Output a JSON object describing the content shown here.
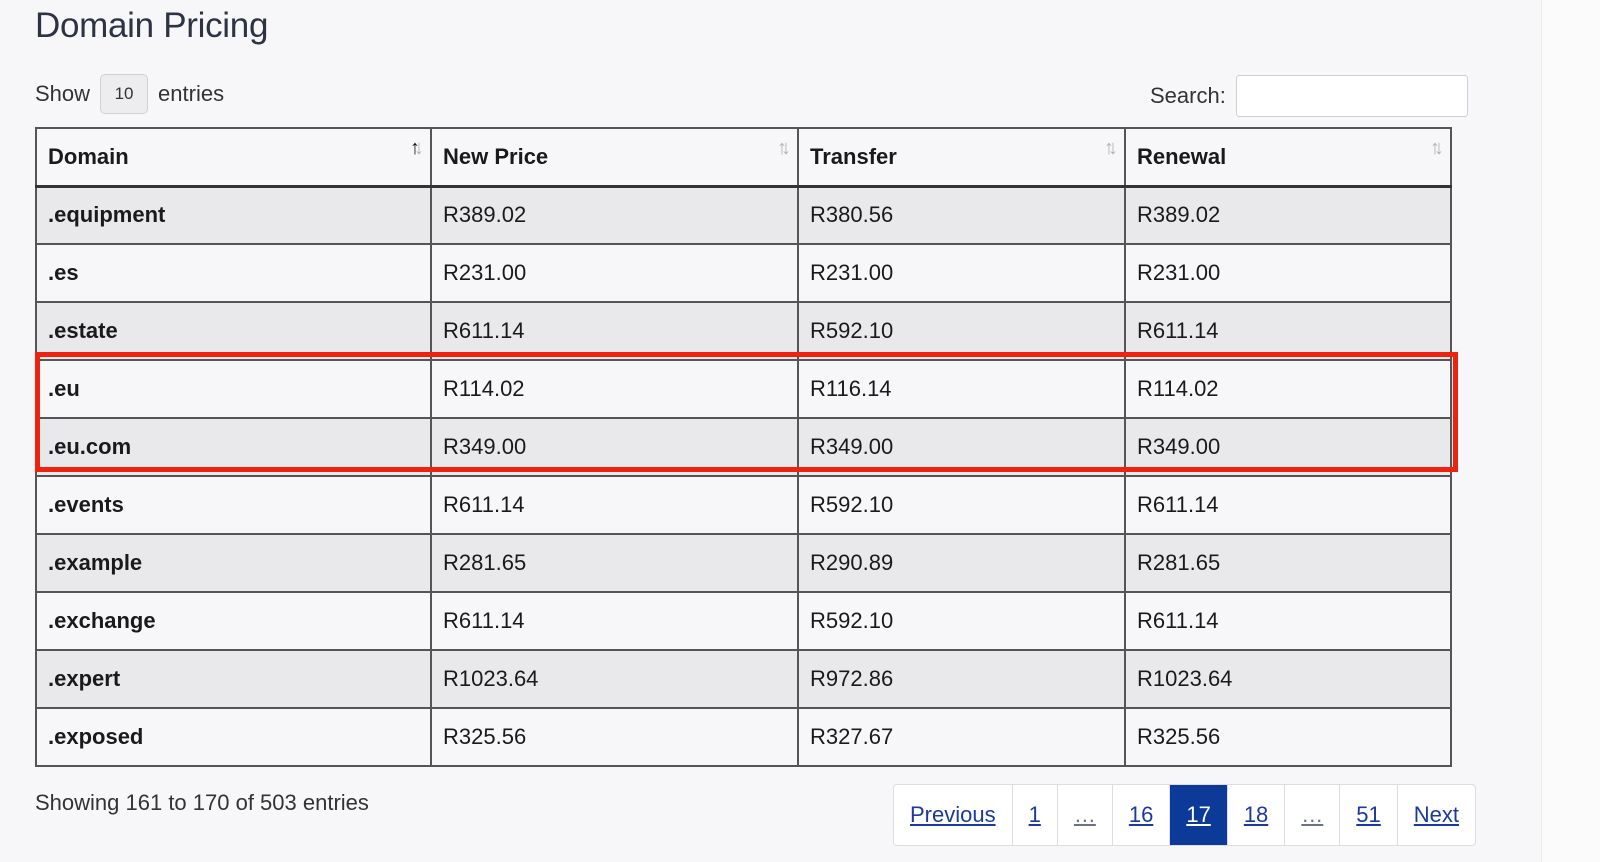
{
  "title": "Domain Pricing",
  "length": {
    "show_label": "Show",
    "value": "10",
    "entries_label": "entries"
  },
  "search": {
    "label": "Search:",
    "value": "",
    "placeholder": ""
  },
  "columns": [
    {
      "label": "Domain",
      "sort": "asc"
    },
    {
      "label": "New Price",
      "sort": "none"
    },
    {
      "label": "Transfer",
      "sort": "none"
    },
    {
      "label": "Renewal",
      "sort": "none"
    }
  ],
  "rows": [
    {
      "domain": ".equipment",
      "new_price": "R389.02",
      "transfer": "R380.56",
      "renewal": "R389.02"
    },
    {
      "domain": ".es",
      "new_price": "R231.00",
      "transfer": "R231.00",
      "renewal": "R231.00"
    },
    {
      "domain": ".estate",
      "new_price": "R611.14",
      "transfer": "R592.10",
      "renewal": "R611.14"
    },
    {
      "domain": ".eu",
      "new_price": "R114.02",
      "transfer": "R116.14",
      "renewal": "R114.02"
    },
    {
      "domain": ".eu.com",
      "new_price": "R349.00",
      "transfer": "R349.00",
      "renewal": "R349.00"
    },
    {
      "domain": ".events",
      "new_price": "R611.14",
      "transfer": "R592.10",
      "renewal": "R611.14"
    },
    {
      "domain": ".example",
      "new_price": "R281.65",
      "transfer": "R290.89",
      "renewal": "R281.65"
    },
    {
      "domain": ".exchange",
      "new_price": "R611.14",
      "transfer": "R592.10",
      "renewal": "R611.14"
    },
    {
      "domain": ".expert",
      "new_price": "R1023.64",
      "transfer": "R972.86",
      "renewal": "R1023.64"
    },
    {
      "domain": ".exposed",
      "new_price": "R325.56",
      "transfer": "R327.67",
      "renewal": "R325.56"
    }
  ],
  "info": "Showing 161 to 170 of 503 entries",
  "pagination": [
    {
      "label": "Previous",
      "type": "prev"
    },
    {
      "label": "1",
      "type": "page"
    },
    {
      "label": "…",
      "type": "ellipsis"
    },
    {
      "label": "16",
      "type": "page"
    },
    {
      "label": "17",
      "type": "page",
      "active": true
    },
    {
      "label": "18",
      "type": "page"
    },
    {
      "label": "…",
      "type": "ellipsis"
    },
    {
      "label": "51",
      "type": "page"
    },
    {
      "label": "Next",
      "type": "next"
    }
  ],
  "colors": {
    "accent": "#0b3a98",
    "highlight": "#ee2211",
    "row_striped": "#e9e9ec"
  }
}
